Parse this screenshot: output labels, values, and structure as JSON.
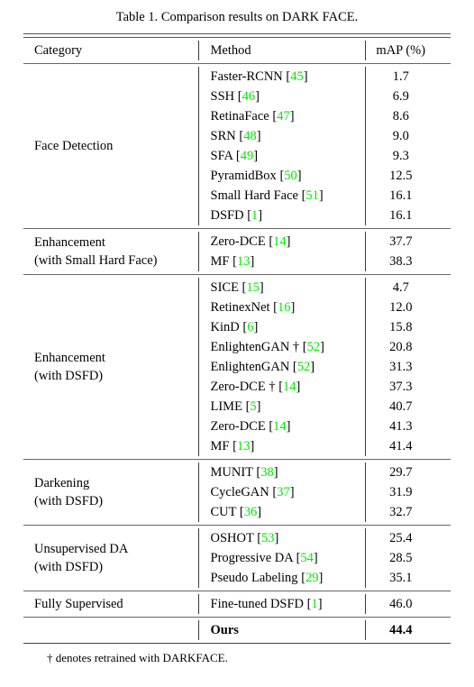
{
  "caption": "Table 1. Comparison results on DARK FACE.",
  "footnote": "† denotes retrained with DARKFACE.",
  "colors": {
    "citation_green": "#00ea00",
    "text": "#000000",
    "rule": "#555555"
  },
  "header": {
    "category": "Category",
    "method": "Method",
    "map": "mAP (%)"
  },
  "groups": [
    {
      "category_lines": [
        "Face Detection"
      ],
      "rows": [
        {
          "method": "Faster-RCNN",
          "cite": "45",
          "dagger": false,
          "map": "1.7"
        },
        {
          "method": "SSH",
          "cite": "46",
          "dagger": false,
          "map": "6.9"
        },
        {
          "method": "RetinaFace",
          "cite": "47",
          "dagger": false,
          "map": "8.6"
        },
        {
          "method": "SRN",
          "cite": "48",
          "dagger": false,
          "map": "9.0"
        },
        {
          "method": "SFA",
          "cite": "49",
          "dagger": false,
          "map": "9.3"
        },
        {
          "method": "PyramidBox",
          "cite": "50",
          "dagger": false,
          "map": "12.5"
        },
        {
          "method": "Small Hard Face",
          "cite": "51",
          "dagger": false,
          "map": "16.1"
        },
        {
          "method": "DSFD",
          "cite": "1",
          "dagger": false,
          "map": "16.1"
        }
      ]
    },
    {
      "category_lines": [
        "Enhancement",
        "(with Small Hard Face)"
      ],
      "rows": [
        {
          "method": "Zero-DCE",
          "cite": "14",
          "dagger": false,
          "map": "37.7"
        },
        {
          "method": "MF",
          "cite": "13",
          "dagger": false,
          "map": "38.3"
        }
      ]
    },
    {
      "category_lines": [
        "Enhancement",
        "(with DSFD)"
      ],
      "rows": [
        {
          "method": "SICE",
          "cite": "15",
          "dagger": false,
          "map": "4.7"
        },
        {
          "method": "RetinexNet",
          "cite": "16",
          "dagger": false,
          "map": "12.0"
        },
        {
          "method": "KinD",
          "cite": "6",
          "dagger": false,
          "map": "15.8"
        },
        {
          "method": "EnlightenGAN",
          "cite": "52",
          "dagger": true,
          "map": "20.8"
        },
        {
          "method": "EnlightenGAN",
          "cite": "52",
          "dagger": false,
          "map": "31.3"
        },
        {
          "method": "Zero-DCE",
          "cite": "14",
          "dagger": true,
          "map": "37.3"
        },
        {
          "method": "LIME",
          "cite": "5",
          "dagger": false,
          "map": "40.7"
        },
        {
          "method": "Zero-DCE",
          "cite": "14",
          "dagger": false,
          "map": "41.3"
        },
        {
          "method": "MF",
          "cite": "13",
          "dagger": false,
          "map": "41.4"
        }
      ]
    },
    {
      "category_lines": [
        "Darkening",
        "(with DSFD)"
      ],
      "rows": [
        {
          "method": "MUNIT",
          "cite": "38",
          "dagger": false,
          "map": "29.7"
        },
        {
          "method": "CycleGAN",
          "cite": "37",
          "dagger": false,
          "map": "31.9"
        },
        {
          "method": "CUT",
          "cite": "36",
          "dagger": false,
          "map": "32.7"
        }
      ]
    },
    {
      "category_lines": [
        "Unsupervised DA",
        "(with DSFD)"
      ],
      "rows": [
        {
          "method": "OSHOT",
          "cite": "53",
          "dagger": false,
          "map": "25.4"
        },
        {
          "method": "Progressive DA",
          "cite": "54",
          "dagger": false,
          "map": "28.5"
        },
        {
          "method": "Pseudo Labeling",
          "cite": "29",
          "dagger": false,
          "map": "35.1"
        }
      ]
    },
    {
      "category_lines": [
        "Fully Supervised"
      ],
      "rows": [
        {
          "method": "Fine-tuned DSFD",
          "cite": "1",
          "dagger": false,
          "map": "46.0"
        }
      ]
    },
    {
      "category_lines": [],
      "rows": [
        {
          "method": "Ours",
          "cite": null,
          "dagger": false,
          "map": "44.4",
          "bold": true
        }
      ]
    }
  ]
}
